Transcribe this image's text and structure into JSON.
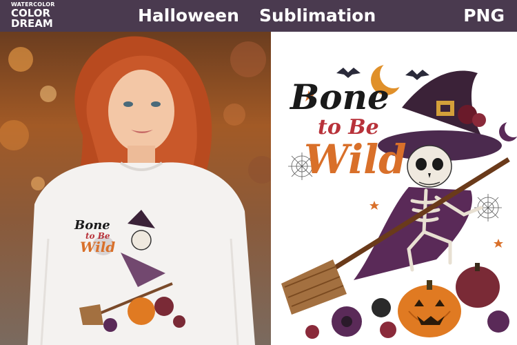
{
  "banner": {
    "logo": {
      "line1": "WATERCOLOR",
      "line2": "COLOR",
      "line3": "DREAM"
    },
    "title_word1": "Halloween",
    "title_word2": "Sublimation",
    "format_label": "PNG",
    "colors": {
      "banner_bg": "#4a3a4f",
      "text": "#ffffff"
    }
  },
  "design": {
    "line1": "Bone",
    "line2": "to Be",
    "line3": "Wild",
    "colors": {
      "bone": "#1a1a1a",
      "to_be": "#b8323a",
      "wild": "#d9702a",
      "hat": "#4b2a4e",
      "pumpkin": "#e07a22"
    }
  },
  "shirt_print": {
    "line1": "Bone",
    "line2": "to Be",
    "line3": "Wild"
  }
}
